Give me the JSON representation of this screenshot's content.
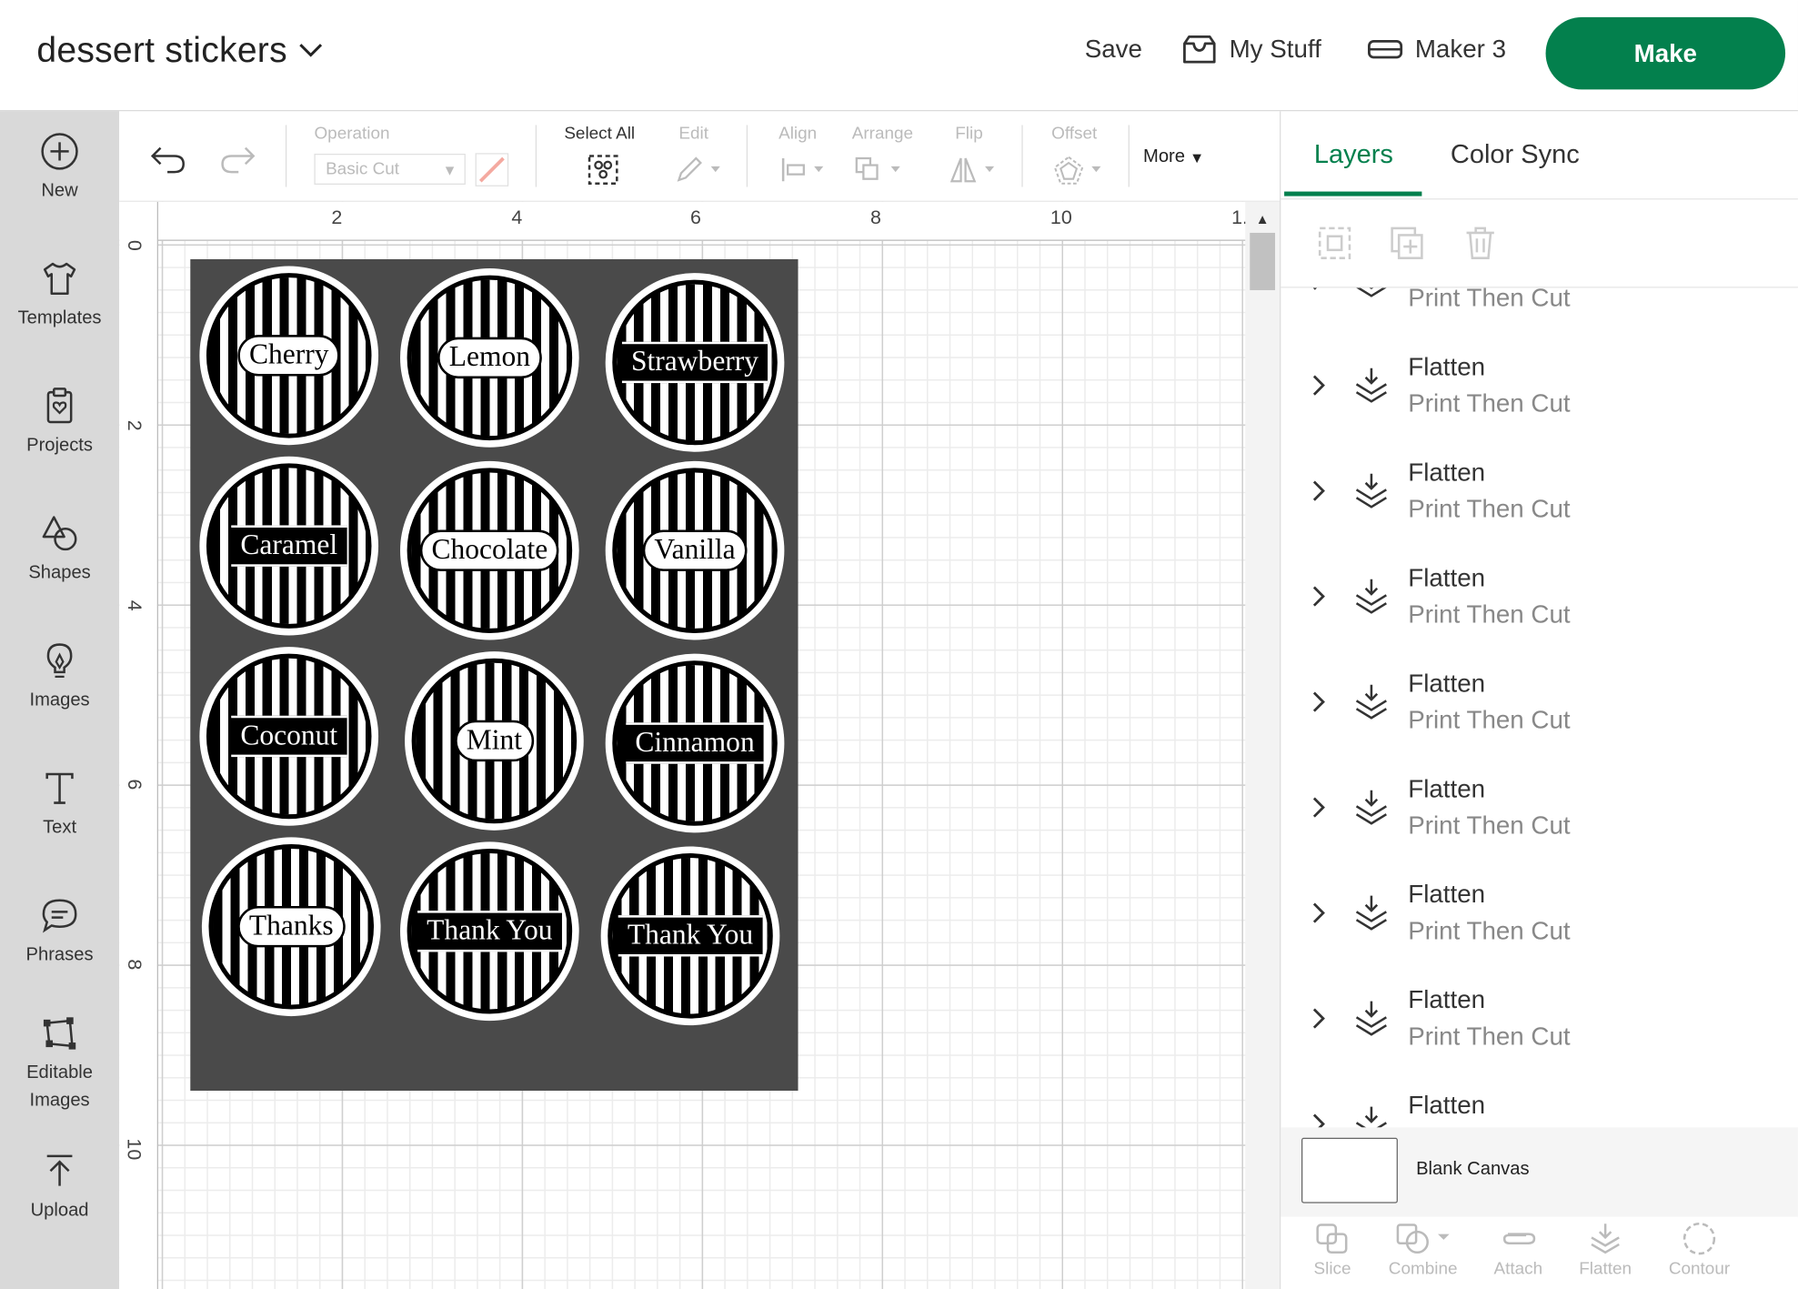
{
  "header": {
    "project_title": "dessert stickers",
    "save_label": "Save",
    "mystuff_label": "My Stuff",
    "machine_label": "Maker 3",
    "make_label": "Make"
  },
  "sidebar": {
    "items": [
      {
        "label": "New",
        "icon": "plus-circle-icon"
      },
      {
        "label": "Templates",
        "icon": "tshirt-icon"
      },
      {
        "label": "Projects",
        "icon": "clipboard-heart-icon"
      },
      {
        "label": "Shapes",
        "icon": "shapes-icon"
      },
      {
        "label": "Images",
        "icon": "lightbulb-icon"
      },
      {
        "label": "Text",
        "icon": "text-icon"
      },
      {
        "label": "Phrases",
        "icon": "speech-bubble-icon"
      },
      {
        "label": "Editable Images",
        "icon": "editable-image-icon"
      },
      {
        "label": "Upload",
        "icon": "upload-icon"
      }
    ]
  },
  "toolbar": {
    "operation_label": "Operation",
    "operation_value": "Basic Cut",
    "select_all_label": "Select All",
    "edit_label": "Edit",
    "align_label": "Align",
    "arrange_label": "Arrange",
    "flip_label": "Flip",
    "offset_label": "Offset",
    "more_label": "More"
  },
  "rulers": {
    "top": [
      "2",
      "4",
      "6",
      "8",
      "10",
      "1."
    ],
    "left": [
      "0",
      "2",
      "4",
      "6",
      "8",
      "10"
    ]
  },
  "stickers": [
    {
      "label": "Cherry",
      "style": "w"
    },
    {
      "label": "Lemon",
      "style": "w"
    },
    {
      "label": "Strawberry",
      "style": "b"
    },
    {
      "label": "Caramel",
      "style": "b"
    },
    {
      "label": "Chocolate",
      "style": "w"
    },
    {
      "label": "Vanilla",
      "style": "w"
    },
    {
      "label": "Coconut",
      "style": "b"
    },
    {
      "label": "Mint",
      "style": "w"
    },
    {
      "label": "Cinnamon",
      "style": "b"
    },
    {
      "label": "Thanks",
      "style": "w"
    },
    {
      "label": "Thank You",
      "style": "b"
    },
    {
      "label": "Thank You",
      "style": "b"
    }
  ],
  "panel": {
    "tab_layers": "Layers",
    "tab_colorsync": "Color Sync",
    "layers": [
      {
        "name": "",
        "type": "Print Then Cut"
      },
      {
        "name": "Flatten",
        "type": "Print Then Cut"
      },
      {
        "name": "Flatten",
        "type": "Print Then Cut"
      },
      {
        "name": "Flatten",
        "type": "Print Then Cut"
      },
      {
        "name": "Flatten",
        "type": "Print Then Cut"
      },
      {
        "name": "Flatten",
        "type": "Print Then Cut"
      },
      {
        "name": "Flatten",
        "type": "Print Then Cut"
      },
      {
        "name": "Flatten",
        "type": "Print Then Cut"
      },
      {
        "name": "Flatten",
        "type": ""
      }
    ],
    "blank_canvas_label": "Blank Canvas",
    "bottom_tools": [
      "Slice",
      "Combine",
      "Attach",
      "Flatten",
      "Contour"
    ]
  },
  "colors": {
    "accent": "#03804d",
    "sidebar_bg": "#d9d9d9",
    "sheet_bg": "#4a4a4a"
  }
}
